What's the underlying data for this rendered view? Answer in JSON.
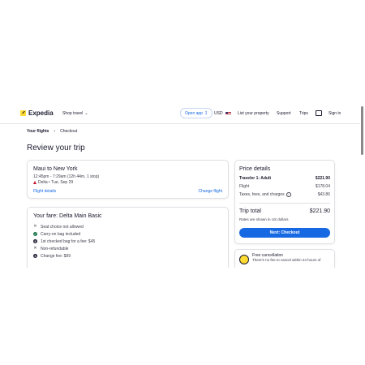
{
  "header": {
    "logo_text": "Expedia",
    "shop_travel": "Shop travel",
    "open_app": "Open app",
    "currency": "USD",
    "list_property": "List your property",
    "support": "Support",
    "trips": "Trips",
    "sign_in": "Sign in"
  },
  "breadcrumb": {
    "items": [
      "Your flights",
      "Checkout"
    ]
  },
  "page_title": "Review your trip",
  "flight": {
    "route": "Maui to New York",
    "time": "12:45pm - 7:29am (12h 44m, 1 stop)",
    "airline_date": "Delta • Tue, Sep 29",
    "details_link": "Flight details",
    "change_link": "Change flight"
  },
  "fare": {
    "title": "Your fare: Delta Main Basic",
    "features": [
      {
        "icon": "x-icon",
        "text": "Seat choice not allowed"
      },
      {
        "icon": "check-icon",
        "text": "Carry-on bag included"
      },
      {
        "icon": "dollar-icon",
        "text": "1st checked bag for a fee: $45"
      },
      {
        "icon": "x-icon",
        "text": "Non-refundable"
      },
      {
        "icon": "dollar-icon",
        "text": "Change fee: $99"
      }
    ]
  },
  "price": {
    "title": "Price details",
    "rows": [
      {
        "label": "Traveler 1: Adult",
        "value": "$221.90"
      },
      {
        "label": "Flight",
        "value": "$178.04"
      },
      {
        "label": "Taxes, fees, and charges",
        "value": "$43.86"
      }
    ],
    "total_label": "Trip total",
    "total_value": "$221.90",
    "note": "Rates are shown in US dollars",
    "checkout_button": "Next: Checkout"
  },
  "cancellation": {
    "title": "Free cancellation",
    "subtitle": "There's no fee to cancel within 24 hours of"
  }
}
